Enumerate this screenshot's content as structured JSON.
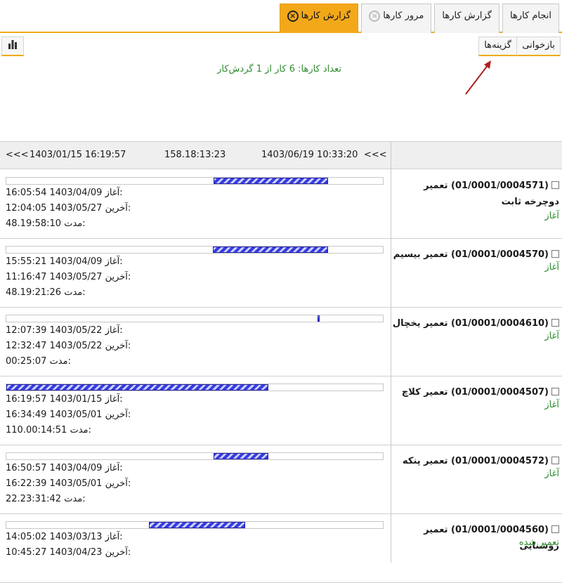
{
  "tabs": [
    {
      "label": "انجام کارها",
      "active": false,
      "icon": null
    },
    {
      "label": "گزارش کارها",
      "active": false,
      "icon": null
    },
    {
      "label": "مرور کارها",
      "active": false,
      "icon": "close-icon-gray"
    },
    {
      "label": "گزارش کارها",
      "active": true,
      "icon": "close-icon"
    }
  ],
  "toolbar": {
    "reload_label": "بازخوانی",
    "options_label": "گزینه‌ها",
    "chart_icon": "bar-chart-icon"
  },
  "summary": "تعداد کارها: 6 کار از 1 گردش‌کار",
  "header": {
    "nav_left": "<<<",
    "start": "1403/01/15 16:19:57",
    "duration": "158.18:13:23",
    "end": "1403/06/19 10:33:20",
    "nav_right": "<<<"
  },
  "labels": {
    "start": "آغاز:",
    "last": "آخرین:",
    "duration": "مدت:"
  },
  "rows": [
    {
      "title": "(01/0001/0004571) تعمیر دوچرخه ثابت",
      "status": "آغاز",
      "start": "16:05:54 1403/04/09",
      "last": "12:04:05 1403/05/27",
      "duration": "48.19:58:10",
      "bar_start": 0.55,
      "bar_end": 0.855
    },
    {
      "title": "(01/0001/0004570) تعمیر بیسیم",
      "status": "آغاز",
      "start": "15:55:21 1403/04/09",
      "last": "11:16:47 1403/05/27",
      "duration": "48.19:21:26",
      "bar_start": 0.548,
      "bar_end": 0.855
    },
    {
      "title": "(01/0001/0004610) تعمیر یخچال",
      "status": "آغاز",
      "start": "12:07:39 1403/05/22",
      "last": "12:32:47 1403/05/22",
      "duration": "00:25:07",
      "bar_start": 0.826,
      "bar_end": 0.83
    },
    {
      "title": "(01/0001/0004507) تعمیر کلاچ",
      "status": "آغاز",
      "start": "16:19:57 1403/01/15",
      "last": "16:34:49 1403/05/01",
      "duration": "110.00:14:51",
      "bar_start": 0.0,
      "bar_end": 0.695
    },
    {
      "title": "(01/0001/0004572) تعمیر پنکه",
      "status": "آغاز",
      "start": "16:50:57 1403/04/09",
      "last": "16:22:39 1403/05/01",
      "duration": "22.23:31:42",
      "bar_start": 0.551,
      "bar_end": 0.695
    },
    {
      "title": "(01/0001/0004560) تعمیر روشنایی",
      "status": "تعمیر شده",
      "start": "14:05:02 1403/03/13",
      "last": "10:45:27 1403/04/23",
      "duration": "",
      "bar_start": 0.378,
      "bar_end": 0.635
    }
  ],
  "colors": {
    "accent": "#f3a81a",
    "status_green": "#2e8a2e",
    "bar_blue": "#3a3ae0"
  }
}
